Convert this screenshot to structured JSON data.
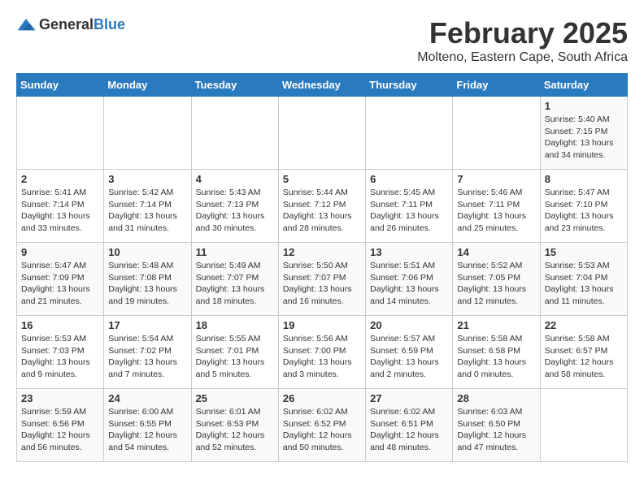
{
  "logo": {
    "general": "General",
    "blue": "Blue"
  },
  "title": "February 2025",
  "subtitle": "Molteno, Eastern Cape, South Africa",
  "headers": [
    "Sunday",
    "Monday",
    "Tuesday",
    "Wednesday",
    "Thursday",
    "Friday",
    "Saturday"
  ],
  "weeks": [
    [
      {
        "day": "",
        "info": ""
      },
      {
        "day": "",
        "info": ""
      },
      {
        "day": "",
        "info": ""
      },
      {
        "day": "",
        "info": ""
      },
      {
        "day": "",
        "info": ""
      },
      {
        "day": "",
        "info": ""
      },
      {
        "day": "1",
        "info": "Sunrise: 5:40 AM\nSunset: 7:15 PM\nDaylight: 13 hours\nand 34 minutes."
      }
    ],
    [
      {
        "day": "2",
        "info": "Sunrise: 5:41 AM\nSunset: 7:14 PM\nDaylight: 13 hours\nand 33 minutes."
      },
      {
        "day": "3",
        "info": "Sunrise: 5:42 AM\nSunset: 7:14 PM\nDaylight: 13 hours\nand 31 minutes."
      },
      {
        "day": "4",
        "info": "Sunrise: 5:43 AM\nSunset: 7:13 PM\nDaylight: 13 hours\nand 30 minutes."
      },
      {
        "day": "5",
        "info": "Sunrise: 5:44 AM\nSunset: 7:12 PM\nDaylight: 13 hours\nand 28 minutes."
      },
      {
        "day": "6",
        "info": "Sunrise: 5:45 AM\nSunset: 7:11 PM\nDaylight: 13 hours\nand 26 minutes."
      },
      {
        "day": "7",
        "info": "Sunrise: 5:46 AM\nSunset: 7:11 PM\nDaylight: 13 hours\nand 25 minutes."
      },
      {
        "day": "8",
        "info": "Sunrise: 5:47 AM\nSunset: 7:10 PM\nDaylight: 13 hours\nand 23 minutes."
      }
    ],
    [
      {
        "day": "9",
        "info": "Sunrise: 5:47 AM\nSunset: 7:09 PM\nDaylight: 13 hours\nand 21 minutes."
      },
      {
        "day": "10",
        "info": "Sunrise: 5:48 AM\nSunset: 7:08 PM\nDaylight: 13 hours\nand 19 minutes."
      },
      {
        "day": "11",
        "info": "Sunrise: 5:49 AM\nSunset: 7:07 PM\nDaylight: 13 hours\nand 18 minutes."
      },
      {
        "day": "12",
        "info": "Sunrise: 5:50 AM\nSunset: 7:07 PM\nDaylight: 13 hours\nand 16 minutes."
      },
      {
        "day": "13",
        "info": "Sunrise: 5:51 AM\nSunset: 7:06 PM\nDaylight: 13 hours\nand 14 minutes."
      },
      {
        "day": "14",
        "info": "Sunrise: 5:52 AM\nSunset: 7:05 PM\nDaylight: 13 hours\nand 12 minutes."
      },
      {
        "day": "15",
        "info": "Sunrise: 5:53 AM\nSunset: 7:04 PM\nDaylight: 13 hours\nand 11 minutes."
      }
    ],
    [
      {
        "day": "16",
        "info": "Sunrise: 5:53 AM\nSunset: 7:03 PM\nDaylight: 13 hours\nand 9 minutes."
      },
      {
        "day": "17",
        "info": "Sunrise: 5:54 AM\nSunset: 7:02 PM\nDaylight: 13 hours\nand 7 minutes."
      },
      {
        "day": "18",
        "info": "Sunrise: 5:55 AM\nSunset: 7:01 PM\nDaylight: 13 hours\nand 5 minutes."
      },
      {
        "day": "19",
        "info": "Sunrise: 5:56 AM\nSunset: 7:00 PM\nDaylight: 13 hours\nand 3 minutes."
      },
      {
        "day": "20",
        "info": "Sunrise: 5:57 AM\nSunset: 6:59 PM\nDaylight: 13 hours\nand 2 minutes."
      },
      {
        "day": "21",
        "info": "Sunrise: 5:58 AM\nSunset: 6:58 PM\nDaylight: 13 hours\nand 0 minutes."
      },
      {
        "day": "22",
        "info": "Sunrise: 5:58 AM\nSunset: 6:57 PM\nDaylight: 12 hours\nand 58 minutes."
      }
    ],
    [
      {
        "day": "23",
        "info": "Sunrise: 5:59 AM\nSunset: 6:56 PM\nDaylight: 12 hours\nand 56 minutes."
      },
      {
        "day": "24",
        "info": "Sunrise: 6:00 AM\nSunset: 6:55 PM\nDaylight: 12 hours\nand 54 minutes."
      },
      {
        "day": "25",
        "info": "Sunrise: 6:01 AM\nSunset: 6:53 PM\nDaylight: 12 hours\nand 52 minutes."
      },
      {
        "day": "26",
        "info": "Sunrise: 6:02 AM\nSunset: 6:52 PM\nDaylight: 12 hours\nand 50 minutes."
      },
      {
        "day": "27",
        "info": "Sunrise: 6:02 AM\nSunset: 6:51 PM\nDaylight: 12 hours\nand 48 minutes."
      },
      {
        "day": "28",
        "info": "Sunrise: 6:03 AM\nSunset: 6:50 PM\nDaylight: 12 hours\nand 47 minutes."
      },
      {
        "day": "",
        "info": ""
      }
    ]
  ]
}
